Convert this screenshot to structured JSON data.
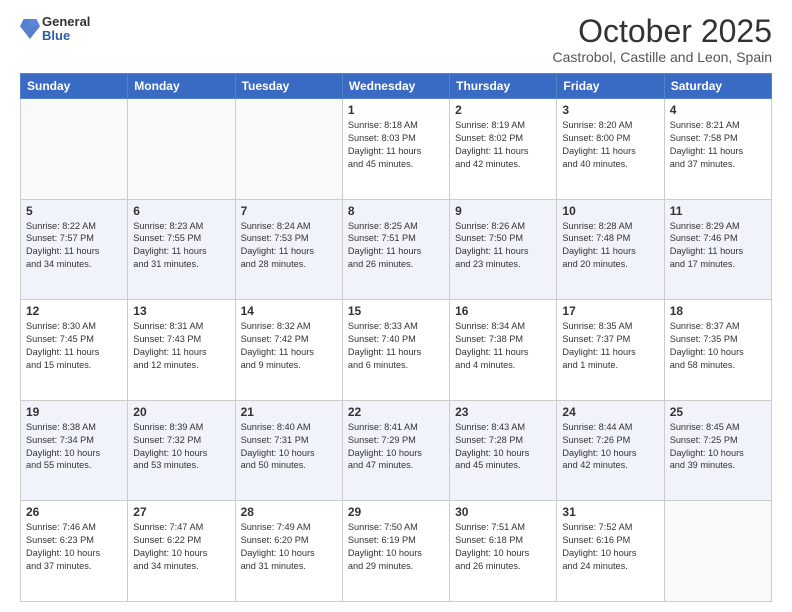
{
  "header": {
    "logo_general": "General",
    "logo_blue": "Blue",
    "month_title": "October 2025",
    "location": "Castrobol, Castille and Leon, Spain"
  },
  "weekdays": [
    "Sunday",
    "Monday",
    "Tuesday",
    "Wednesday",
    "Thursday",
    "Friday",
    "Saturday"
  ],
  "weeks": [
    [
      {
        "day": "",
        "info": ""
      },
      {
        "day": "",
        "info": ""
      },
      {
        "day": "",
        "info": ""
      },
      {
        "day": "1",
        "info": "Sunrise: 8:18 AM\nSunset: 8:03 PM\nDaylight: 11 hours\nand 45 minutes."
      },
      {
        "day": "2",
        "info": "Sunrise: 8:19 AM\nSunset: 8:02 PM\nDaylight: 11 hours\nand 42 minutes."
      },
      {
        "day": "3",
        "info": "Sunrise: 8:20 AM\nSunset: 8:00 PM\nDaylight: 11 hours\nand 40 minutes."
      },
      {
        "day": "4",
        "info": "Sunrise: 8:21 AM\nSunset: 7:58 PM\nDaylight: 11 hours\nand 37 minutes."
      }
    ],
    [
      {
        "day": "5",
        "info": "Sunrise: 8:22 AM\nSunset: 7:57 PM\nDaylight: 11 hours\nand 34 minutes."
      },
      {
        "day": "6",
        "info": "Sunrise: 8:23 AM\nSunset: 7:55 PM\nDaylight: 11 hours\nand 31 minutes."
      },
      {
        "day": "7",
        "info": "Sunrise: 8:24 AM\nSunset: 7:53 PM\nDaylight: 11 hours\nand 28 minutes."
      },
      {
        "day": "8",
        "info": "Sunrise: 8:25 AM\nSunset: 7:51 PM\nDaylight: 11 hours\nand 26 minutes."
      },
      {
        "day": "9",
        "info": "Sunrise: 8:26 AM\nSunset: 7:50 PM\nDaylight: 11 hours\nand 23 minutes."
      },
      {
        "day": "10",
        "info": "Sunrise: 8:28 AM\nSunset: 7:48 PM\nDaylight: 11 hours\nand 20 minutes."
      },
      {
        "day": "11",
        "info": "Sunrise: 8:29 AM\nSunset: 7:46 PM\nDaylight: 11 hours\nand 17 minutes."
      }
    ],
    [
      {
        "day": "12",
        "info": "Sunrise: 8:30 AM\nSunset: 7:45 PM\nDaylight: 11 hours\nand 15 minutes."
      },
      {
        "day": "13",
        "info": "Sunrise: 8:31 AM\nSunset: 7:43 PM\nDaylight: 11 hours\nand 12 minutes."
      },
      {
        "day": "14",
        "info": "Sunrise: 8:32 AM\nSunset: 7:42 PM\nDaylight: 11 hours\nand 9 minutes."
      },
      {
        "day": "15",
        "info": "Sunrise: 8:33 AM\nSunset: 7:40 PM\nDaylight: 11 hours\nand 6 minutes."
      },
      {
        "day": "16",
        "info": "Sunrise: 8:34 AM\nSunset: 7:38 PM\nDaylight: 11 hours\nand 4 minutes."
      },
      {
        "day": "17",
        "info": "Sunrise: 8:35 AM\nSunset: 7:37 PM\nDaylight: 11 hours\nand 1 minute."
      },
      {
        "day": "18",
        "info": "Sunrise: 8:37 AM\nSunset: 7:35 PM\nDaylight: 10 hours\nand 58 minutes."
      }
    ],
    [
      {
        "day": "19",
        "info": "Sunrise: 8:38 AM\nSunset: 7:34 PM\nDaylight: 10 hours\nand 55 minutes."
      },
      {
        "day": "20",
        "info": "Sunrise: 8:39 AM\nSunset: 7:32 PM\nDaylight: 10 hours\nand 53 minutes."
      },
      {
        "day": "21",
        "info": "Sunrise: 8:40 AM\nSunset: 7:31 PM\nDaylight: 10 hours\nand 50 minutes."
      },
      {
        "day": "22",
        "info": "Sunrise: 8:41 AM\nSunset: 7:29 PM\nDaylight: 10 hours\nand 47 minutes."
      },
      {
        "day": "23",
        "info": "Sunrise: 8:43 AM\nSunset: 7:28 PM\nDaylight: 10 hours\nand 45 minutes."
      },
      {
        "day": "24",
        "info": "Sunrise: 8:44 AM\nSunset: 7:26 PM\nDaylight: 10 hours\nand 42 minutes."
      },
      {
        "day": "25",
        "info": "Sunrise: 8:45 AM\nSunset: 7:25 PM\nDaylight: 10 hours\nand 39 minutes."
      }
    ],
    [
      {
        "day": "26",
        "info": "Sunrise: 7:46 AM\nSunset: 6:23 PM\nDaylight: 10 hours\nand 37 minutes."
      },
      {
        "day": "27",
        "info": "Sunrise: 7:47 AM\nSunset: 6:22 PM\nDaylight: 10 hours\nand 34 minutes."
      },
      {
        "day": "28",
        "info": "Sunrise: 7:49 AM\nSunset: 6:20 PM\nDaylight: 10 hours\nand 31 minutes."
      },
      {
        "day": "29",
        "info": "Sunrise: 7:50 AM\nSunset: 6:19 PM\nDaylight: 10 hours\nand 29 minutes."
      },
      {
        "day": "30",
        "info": "Sunrise: 7:51 AM\nSunset: 6:18 PM\nDaylight: 10 hours\nand 26 minutes."
      },
      {
        "day": "31",
        "info": "Sunrise: 7:52 AM\nSunset: 6:16 PM\nDaylight: 10 hours\nand 24 minutes."
      },
      {
        "day": "",
        "info": ""
      }
    ]
  ]
}
